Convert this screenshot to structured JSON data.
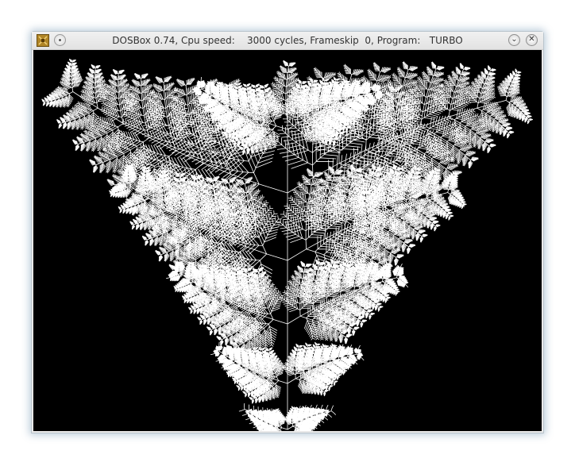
{
  "window": {
    "title": "DOSBox 0.74, Cpu speed:    3000 cycles, Frameskip  0, Program:   TURBO",
    "app_icon": "dosbox-icon",
    "left_button_icon": "pin-icon",
    "minimize_icon": "chevron-down-icon",
    "minimize_glyph": "⌄",
    "close_icon": "close-icon",
    "close_glyph": "✕"
  },
  "screen": {
    "background": "#000000",
    "drawing_color": "#ffffff",
    "content": "fractal fern drawing"
  }
}
